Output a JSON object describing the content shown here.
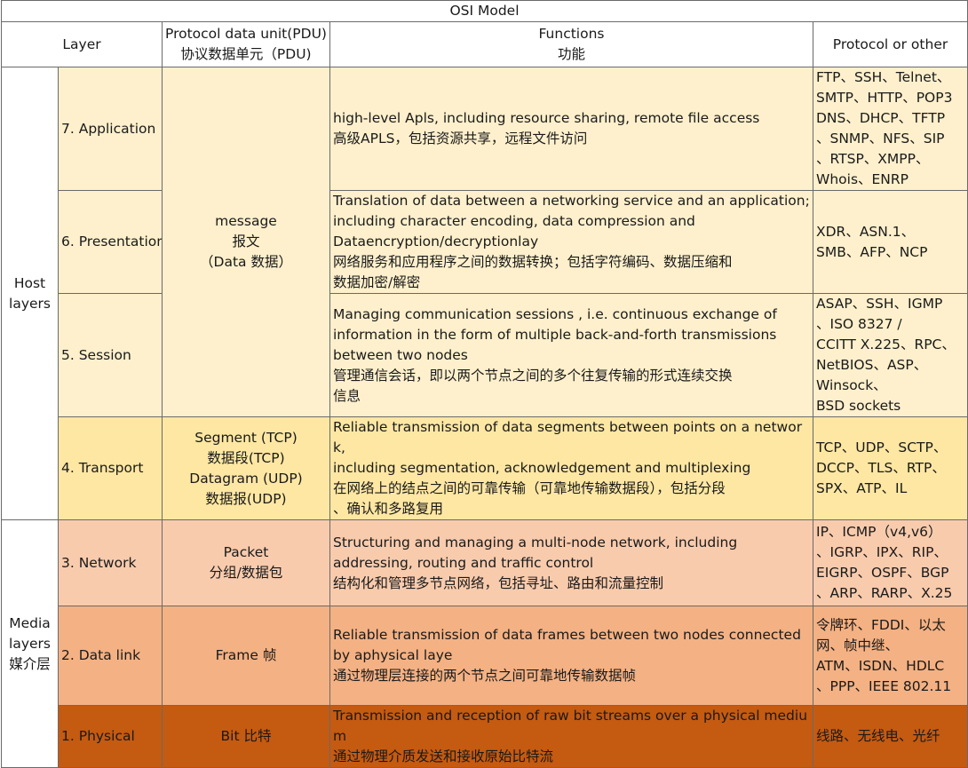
{
  "title": "OSI Model",
  "header": {
    "layer": "Layer",
    "pdu_en": "Protocol data unit(PDU)",
    "pdu_zh": "协议数据单元（PDU)",
    "functions_en": "Functions",
    "functions_zh": "功能",
    "protocol": "Protocol or other"
  },
  "groups": {
    "host": [
      "Host",
      "layers"
    ],
    "media": [
      "Media",
      "layers",
      "媒介层"
    ]
  },
  "pdu": {
    "message": [
      "message",
      "报文",
      "（Data 数据）"
    ],
    "segment": [
      "Segment (TCP)",
      "数据段(TCP)",
      "Datagram (UDP)",
      "数据报(UDP)"
    ],
    "packet": [
      "Packet",
      "分组/数据包"
    ],
    "frame": "Frame 帧",
    "bit": "Bit 比特"
  },
  "rows": [
    {
      "layer": "7. Application",
      "functions": [
        "high-level Apls, including resource sharing, remote file access",
        "高级APLS，包括资源共享，远程文件访问"
      ],
      "protocols": [
        "FTP、SSH、Telnet、",
        "SMTP、HTTP、POP3",
        "DNS、DHCP、TFTP",
        "、SNMP、NFS、SIP",
        "、RTSP、XMPP、",
        "Whois、ENRP"
      ]
    },
    {
      "layer": "6. Presentation",
      "functions": [
        "Translation of data between a networking service and an application;",
        "including character encoding, data compression and",
        "Dataencryption/decryptionlay",
        "网络服务和应用程序之间的数据转换；包括字符编码、数据压缩和",
        "数据加密/解密"
      ],
      "protocols": [
        "XDR、ASN.1、",
        "SMB、AFP、NCP"
      ]
    },
    {
      "layer": "5. Session",
      "functions": [
        "Managing communication sessions , i.e. continuous exchange of",
        "information in the form of multiple back-and-forth transmissions",
        "between two nodes",
        "管理通信会话，即以两个节点之间的多个往复传输的形式连续交换",
        "信息"
      ],
      "protocols": [
        "ASAP、SSH、IGMP",
        "、ISO 8327 /",
        "CCITT X.225、RPC、",
        "NetBIOS、ASP、",
        "Winsock、",
        "BSD sockets"
      ]
    },
    {
      "layer": "4. Transport",
      "functions": [
        "Reliable transmission of data segments between points on a network,",
        "including segmentation, acknowledgement and multiplexing",
        "在网络上的结点之间的可靠传输（可靠地传输数据段），包括分段",
        "、确认和多路复用"
      ],
      "protocols": [
        "TCP、UDP、SCTP、",
        "DCCP、TLS、RTP、",
        "SPX、ATP、IL"
      ]
    },
    {
      "layer": "3. Network",
      "functions": [
        "Structuring and managing a multi-node network, including",
        "addressing, routing and traffic control",
        "结构化和管理多节点网络，包括寻址、路由和流量控制"
      ],
      "protocols": [
        "IP、ICMP（v4,v6）",
        "、IGRP、IPX、RIP、",
        "EIGRP、OSPF、BGP",
        "、ARP、RARP、X.25"
      ]
    },
    {
      "layer": "2. Data link",
      "functions": [
        "Reliable transmission of data frames between two nodes connected",
        "by aphysical laye",
        "通过物理层连接的两个节点之间可靠地传输数据帧"
      ],
      "protocols": [
        "令牌环、FDDI、以太",
        "网、帧中继、",
        "ATM、ISDN、HDLC",
        "、PPP、IEEE 802.11"
      ]
    },
    {
      "layer": "1. Physical",
      "functions": [
        "Transmission and reception of raw bit streams over a physical medium",
        "通过物理介质发送和接收原始比特流"
      ],
      "protocols": [
        "线路、无线电、光纤"
      ]
    }
  ],
  "colors": {
    "host": "#fef0cc",
    "transport": "#fde7a3",
    "network": "#f8cbad",
    "datalink": "#f4b183",
    "physical": "#c55a11",
    "border": "#6a6a6a"
  }
}
